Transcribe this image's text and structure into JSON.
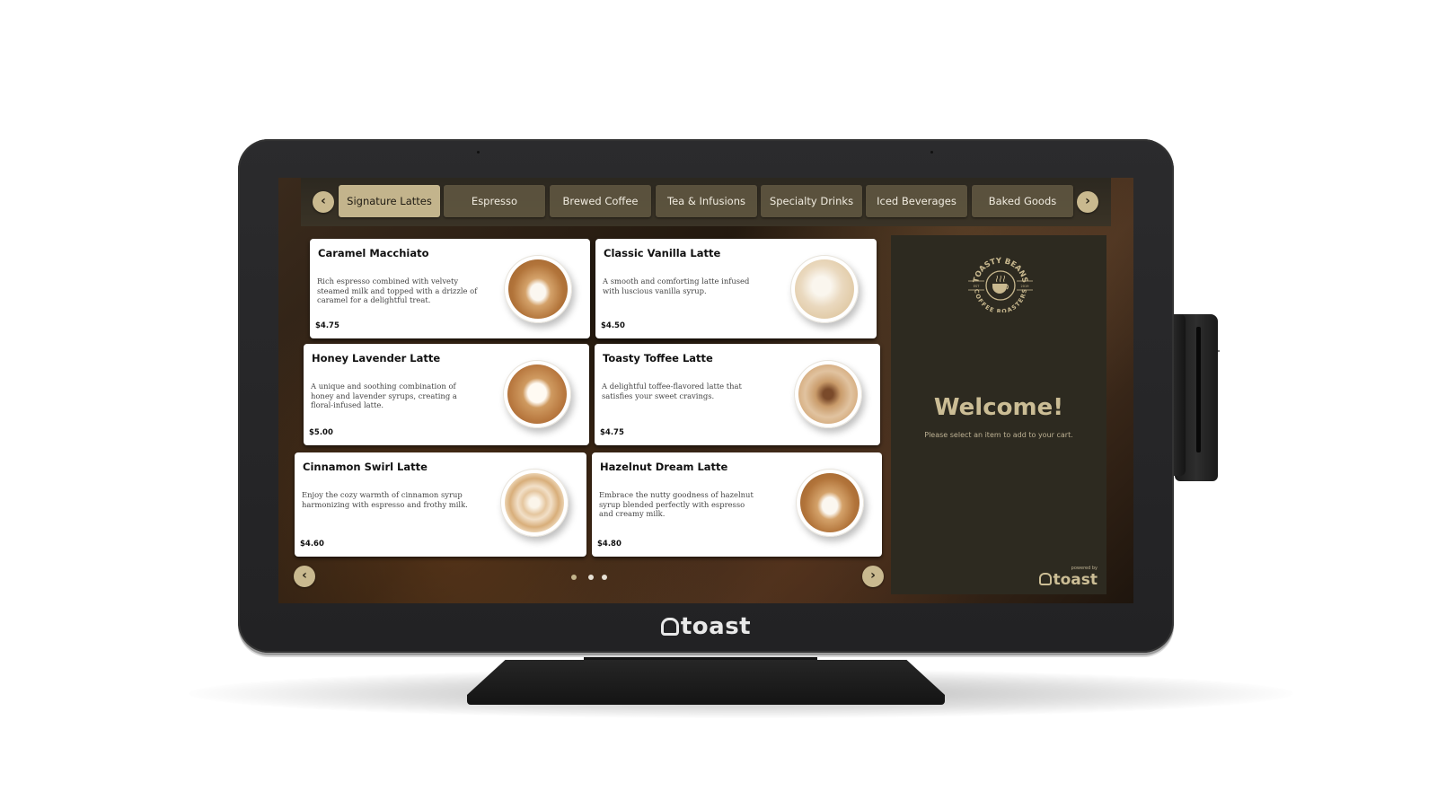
{
  "device": {
    "brand": "toast",
    "bezel_logo_icon": "toast-logo-icon"
  },
  "category_nav": {
    "prev_icon": "chevron-left-icon",
    "next_icon": "chevron-right-icon",
    "prev_glyph": "‹",
    "next_glyph": "›",
    "active_index": 0,
    "tabs": [
      {
        "label": "Signature Lattes"
      },
      {
        "label": "Espresso"
      },
      {
        "label": "Brewed Coffee"
      },
      {
        "label": "Tea & Infusions"
      },
      {
        "label": "Specialty Drinks"
      },
      {
        "label": "Iced Beverages"
      },
      {
        "label": "Baked Goods"
      }
    ]
  },
  "menu_items": [
    {
      "name": "Caramel Macchiato",
      "description": "Rich espresso combined with velvety steamed milk and topped with a drizzle of caramel for a delightful treat.",
      "price": "$4.75",
      "image": "latte-art-rosetta"
    },
    {
      "name": "Classic Vanilla Latte",
      "description": "A smooth and comforting latte infused with luscious vanilla syrup.",
      "price": "$4.50",
      "image": "vanilla-latte"
    },
    {
      "name": "Honey Lavender Latte",
      "description": "A unique and soothing combination of honey and lavender syrups, creating a floral-infused latte.",
      "price": "$5.00",
      "image": "latte-art-heart"
    },
    {
      "name": "Toasty Toffee Latte",
      "description": "A delightful toffee-flavored latte that satisfies your sweet cravings.",
      "price": "$4.75",
      "image": "latte-cocoa-dusted"
    },
    {
      "name": "Cinnamon Swirl Latte",
      "description": "Enjoy the cozy warmth of cinnamon syrup harmonizing with espresso and frothy milk.",
      "price": "$4.60",
      "image": "latte-swirl"
    },
    {
      "name": "Hazelnut Dream Latte",
      "description": "Embrace the nutty goodness of hazelnut syrup blended perfectly with espresso and creamy milk.",
      "price": "$4.80",
      "image": "latte-art-rosetta"
    }
  ],
  "pagination": {
    "current_page": 1,
    "total_pages": 3,
    "prev_glyph": "‹",
    "next_glyph": "›"
  },
  "side_panel": {
    "logo": {
      "top_text": "TOASTY BEANS",
      "bottom_text": "COFFEE ROASTERS",
      "left_tag": "EST",
      "right_tag": "2019"
    },
    "welcome_title": "Welcome!",
    "welcome_subtitle": "Please select an item to add to your cart.",
    "powered_by": "powered by",
    "brand": "toast"
  },
  "colors": {
    "accent": "#c3b48c",
    "tab_inactive": "#625842",
    "side_panel_bg": "#2d2a20",
    "welcome_text": "#cbbd95"
  }
}
